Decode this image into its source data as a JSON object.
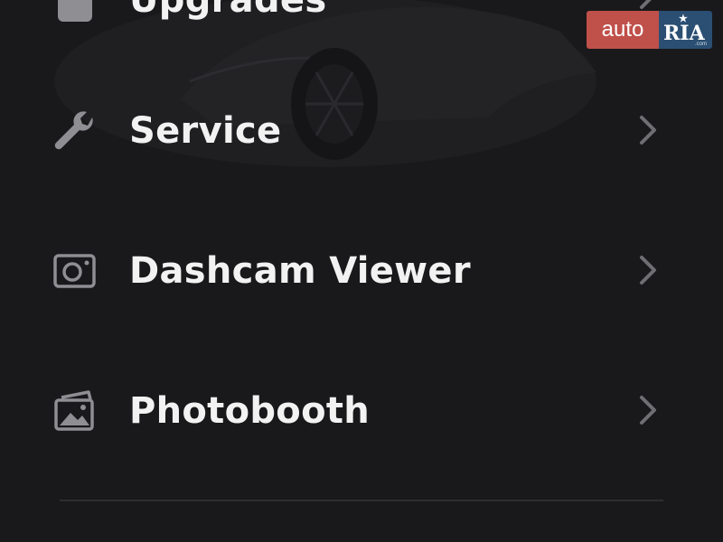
{
  "menu": {
    "items": [
      {
        "label": "Upgrades",
        "icon": "upgrades-icon"
      },
      {
        "label": "Service",
        "icon": "wrench-icon"
      },
      {
        "label": "Dashcam Viewer",
        "icon": "dashcam-icon"
      },
      {
        "label": "Photobooth",
        "icon": "photos-icon"
      }
    ]
  },
  "watermark": {
    "left_text": "auto",
    "right_text": "RIA",
    "suffix": ".com"
  },
  "colors": {
    "background": "#19191b",
    "text": "#f2f2f2",
    "icon": "#8e8e93",
    "chevron": "#6e6e73",
    "badge_red": "#c0504a",
    "badge_blue": "#2b4f73"
  }
}
